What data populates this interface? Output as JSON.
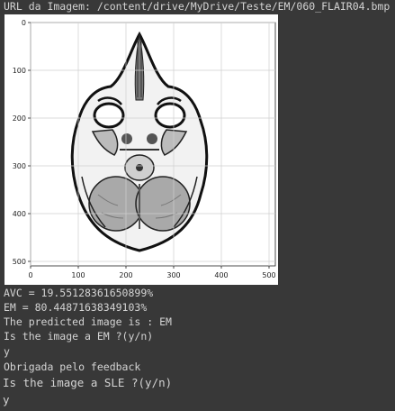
{
  "output": {
    "url_line": "URL da Imagem: /content/drive/MyDrive/Teste/EM/060_FLAIR04.bmp",
    "figure": {
      "y_ticks": [
        "0",
        "100",
        "200",
        "300",
        "400",
        "500"
      ],
      "x_ticks": [
        "0",
        "100",
        "200",
        "300",
        "400",
        "500"
      ],
      "grid": true
    },
    "lines": [
      "AVC = 19.55128361650899%",
      "EM = 80.44871638349103%",
      "The predicted image is : EM",
      "Is the image a EM ?(y/n)",
      "y",
      "Obrigada pelo feedback",
      "Is the image a SLE ?(y/n)",
      "y"
    ]
  }
}
